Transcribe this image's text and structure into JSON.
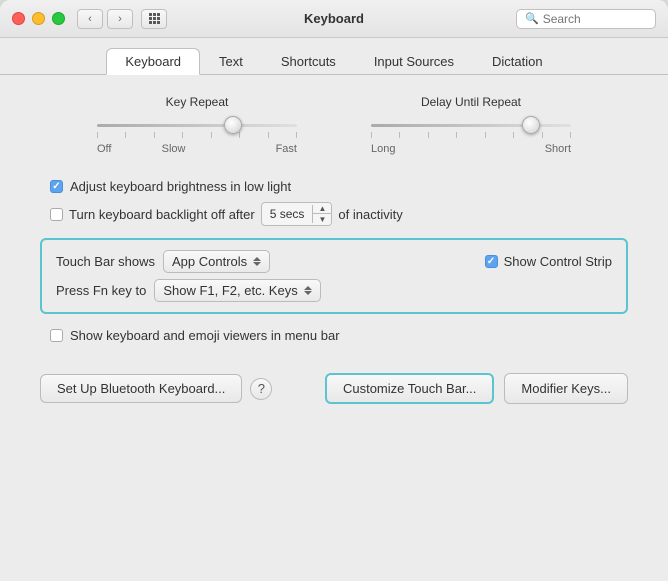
{
  "window": {
    "title": "Keyboard"
  },
  "search": {
    "placeholder": "Search"
  },
  "tabs": [
    {
      "id": "keyboard",
      "label": "Keyboard",
      "active": true
    },
    {
      "id": "text",
      "label": "Text",
      "active": false
    },
    {
      "id": "shortcuts",
      "label": "Shortcuts",
      "active": false
    },
    {
      "id": "input_sources",
      "label": "Input Sources",
      "active": false
    },
    {
      "id": "dictation",
      "label": "Dictation",
      "active": false
    }
  ],
  "sliders": {
    "key_repeat": {
      "label": "Key Repeat",
      "left_label": "Off",
      "left2_label": "Slow",
      "right_label": "Fast",
      "thumb_position": "68%"
    },
    "delay_until_repeat": {
      "label": "Delay Until Repeat",
      "left_label": "Long",
      "right_label": "Short",
      "thumb_position": "80%"
    }
  },
  "checkboxes": {
    "brightness": {
      "label": "Adjust keyboard brightness in low light",
      "checked": true
    },
    "backlight": {
      "label": "Turn keyboard backlight off after",
      "checked": false
    },
    "viewers": {
      "label": "Show keyboard and emoji viewers in menu bar",
      "checked": false
    }
  },
  "inactivity": {
    "value": "5 secs",
    "suffix": "of inactivity"
  },
  "touch_bar": {
    "shows_label": "Touch Bar shows",
    "shows_value": "App Controls",
    "show_control_strip_label": "Show Control Strip",
    "show_control_strip_checked": true,
    "fn_label": "Press Fn key to",
    "fn_value": "Show F1, F2, etc. Keys"
  },
  "buttons": {
    "customize": "Customize Touch Bar...",
    "modifier": "Modifier Keys...",
    "bluetooth": "Set Up Bluetooth Keyboard..."
  }
}
